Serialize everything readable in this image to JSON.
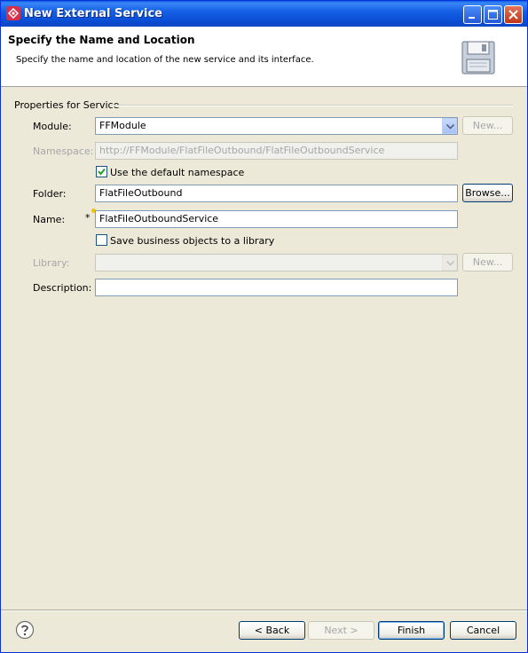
{
  "window": {
    "title": "New External Service"
  },
  "banner": {
    "title": "Specify the Name and Location",
    "description": "Specify the name and location of the new service and its interface."
  },
  "group": {
    "title": "Properties for Service"
  },
  "form": {
    "module": {
      "label": "Module:",
      "value": "FFModule",
      "new_label": "New..."
    },
    "namespace": {
      "label": "Namespace:",
      "value": "http://FFModule/FlatFileOutbound/FlatFileOutboundService"
    },
    "default_namespace": {
      "label": "Use the default namespace",
      "checked": true
    },
    "folder": {
      "label": "Folder:",
      "value": "FlatFileOutbound",
      "browse_label": "Browse..."
    },
    "name": {
      "label": "Name:",
      "value": "FlatFileOutboundService",
      "required_mark": "*"
    },
    "save_library": {
      "label": "Save business objects to a library",
      "checked": false
    },
    "library": {
      "label": "Library:",
      "value": "",
      "new_label": "New..."
    },
    "description": {
      "label": "Description:",
      "value": ""
    }
  },
  "footer": {
    "back_label": "< Back",
    "next_label": "Next >",
    "finish_label": "Finish",
    "cancel_label": "Cancel"
  },
  "icons": {
    "app": "service-icon",
    "banner": "floppy-disk-icon",
    "help": "help-icon"
  }
}
